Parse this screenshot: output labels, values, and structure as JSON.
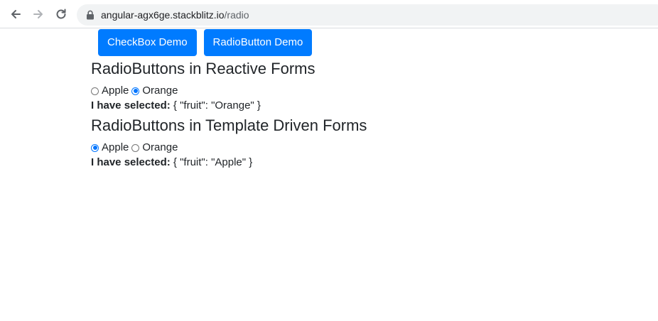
{
  "browser": {
    "url_host": "angular-agx6ge.stackblitz.io",
    "url_path": "/radio"
  },
  "nav": {
    "checkbox_label": "CheckBox Demo",
    "radio_label": "RadioButton Demo"
  },
  "reactive": {
    "heading": "RadioButtons in Reactive Forms",
    "options": [
      {
        "label": "Apple",
        "checked": false
      },
      {
        "label": "Orange",
        "checked": true
      }
    ],
    "selected_prefix": "I have selected:",
    "selected_value": " { \"fruit\": \"Orange\" }"
  },
  "template": {
    "heading": "RadioButtons in Template Driven Forms",
    "options": [
      {
        "label": "Apple",
        "checked": true
      },
      {
        "label": "Orange",
        "checked": false
      }
    ],
    "selected_prefix": "I have selected:",
    "selected_value": " { \"fruit\": \"Apple\" }"
  },
  "colors": {
    "primary": "#007bff",
    "radio_checked": "#0075ff"
  }
}
